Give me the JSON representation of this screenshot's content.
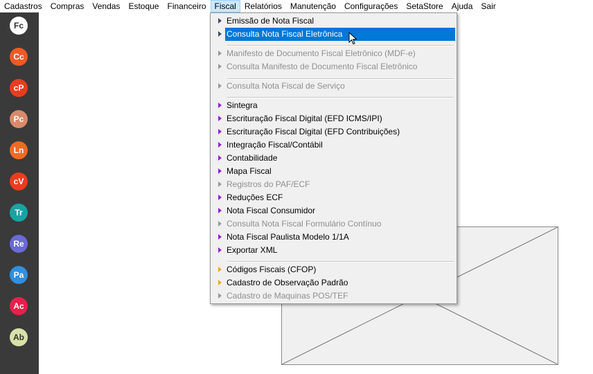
{
  "menubar": {
    "items": [
      "Cadastros",
      "Compras",
      "Vendas",
      "Estoque",
      "Financeiro",
      "Fiscal",
      "Relatórios",
      "Manutenção",
      "Configurações",
      "SetaStore",
      "Ajuda",
      "Sair"
    ]
  },
  "sidebar": {
    "buttons": [
      {
        "label": "Fc",
        "color": "#ffffff",
        "text_color": "#333333"
      },
      {
        "label": "Cc",
        "color": "#f05a28"
      },
      {
        "label": "cP",
        "color": "#ee3b1f"
      },
      {
        "label": "Pc",
        "color": "#d98a6b"
      },
      {
        "label": "Ln",
        "color": "#f06a24"
      },
      {
        "label": "cV",
        "color": "#ee3b1f"
      },
      {
        "label": "Tr",
        "color": "#1aa3a3"
      },
      {
        "label": "Re",
        "color": "#6a6ad8"
      },
      {
        "label": "Pa",
        "color": "#2f8fe0"
      },
      {
        "label": "Ac",
        "color": "#e8204a"
      },
      {
        "label": "Ab",
        "color": "#d7e2a8",
        "text_color": "#333333"
      }
    ]
  },
  "fiscal_menu": {
    "items": [
      {
        "label": "Emissão de Nota Fiscal",
        "state": "enabled",
        "icon": "arrow-blue"
      },
      {
        "label": "Consulta Nota Fiscal Eletrônica",
        "state": "selected",
        "icon": "arrow-blue"
      },
      {
        "label": "Manifesto de Documento Fiscal Eletrônico (MDF-e)",
        "state": "disabled",
        "icon": "arrow-gray"
      },
      {
        "label": "Consulta Manifesto de Documento Fiscal Eletrônico",
        "state": "disabled",
        "icon": "arrow-gray"
      },
      {
        "label": "Consulta Nota Fiscal de Serviço",
        "state": "disabled",
        "icon": "arrow-gray"
      },
      {
        "label": "Sintegra",
        "state": "enabled",
        "icon": "arrow-purple"
      },
      {
        "label": "Escrituração Fiscal Digital (EFD ICMS/IPI)",
        "state": "enabled",
        "icon": "arrow-purple"
      },
      {
        "label": "Escrituração Fiscal Digital (EFD Contribuições)",
        "state": "enabled",
        "icon": "arrow-purple"
      },
      {
        "label": "Integração Fiscal/Contábil",
        "state": "enabled",
        "icon": "arrow-purple"
      },
      {
        "label": "Contabilidade",
        "state": "enabled",
        "icon": "arrow-purple"
      },
      {
        "label": "Mapa Fiscal",
        "state": "enabled",
        "icon": "arrow-purple"
      },
      {
        "label": "Registros do PAF/ECF",
        "state": "disabled",
        "icon": "arrow-purple"
      },
      {
        "label": "Reduções ECF",
        "state": "enabled",
        "icon": "arrow-purple"
      },
      {
        "label": "Nota Fiscal Consumidor",
        "state": "enabled",
        "icon": "arrow-purple"
      },
      {
        "label": "Consulta Nota Fiscal Formulário Contínuo",
        "state": "disabled",
        "icon": "arrow-gray"
      },
      {
        "label": "Nota Fiscal Paulista Modelo 1/1A",
        "state": "enabled",
        "icon": "arrow-purple"
      },
      {
        "label": "Exportar XML",
        "state": "enabled",
        "icon": "arrow-purple"
      },
      {
        "label": "Códigos Fiscais (CFOP)",
        "state": "enabled",
        "icon": "arrow-orange"
      },
      {
        "label": "Cadastro de Observação Padrão",
        "state": "enabled",
        "icon": "arrow-orange"
      },
      {
        "label": "Cadastro de Maquinas POS/TEF",
        "state": "disabled",
        "icon": "arrow-gray"
      }
    ]
  }
}
